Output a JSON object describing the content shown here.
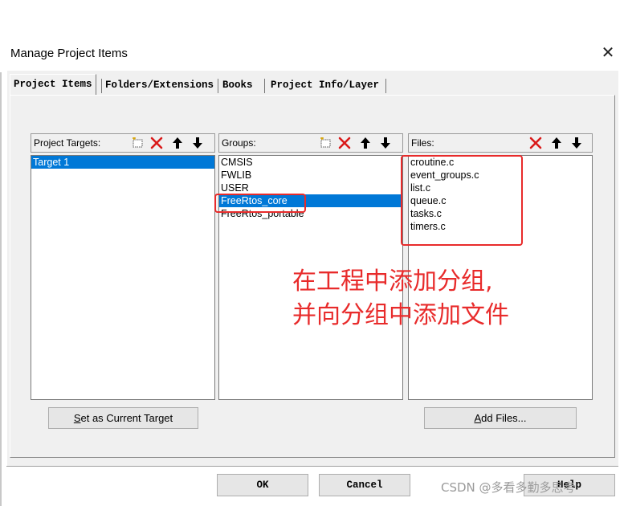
{
  "window": {
    "title": "Manage Project Items",
    "close_glyph": "✕"
  },
  "tabs": [
    {
      "label": "Project Items"
    },
    {
      "label": "Folders/Extensions"
    },
    {
      "label": "Books"
    },
    {
      "label": "Project Info/Layer"
    }
  ],
  "targets": {
    "header": "Project Targets:",
    "items": [
      "Target 1"
    ],
    "selected_index": 0,
    "set_button": "Set as Current Target",
    "set_button_mnemonic": "S"
  },
  "groups": {
    "header": "Groups:",
    "items": [
      "CMSIS",
      "FWLIB",
      "USER",
      "FreeRtos_core",
      "FreeRtos_portable"
    ],
    "selected_index": 3
  },
  "files": {
    "header": "Files:",
    "items": [
      "croutine.c",
      "event_groups.c",
      "list.c",
      "queue.c",
      "tasks.c",
      "timers.c"
    ],
    "add_button": "Add Files...",
    "add_button_mnemonic": "A"
  },
  "toolbar_icons": {
    "new": "new-item-icon",
    "delete": "delete-x-icon",
    "up": "move-up-arrow-icon",
    "down": "move-down-arrow-icon"
  },
  "footer": {
    "ok": "OK",
    "cancel": "Cancel",
    "help": "Help"
  },
  "annotation": {
    "line1": "在工程中添加分组,",
    "line2": "并向分组中添加文件",
    "color": "#e82b2b"
  },
  "watermark": "CSDN @多看多勤多思考",
  "colors": {
    "selection": "#0078d7",
    "dialog_bg": "#f0f0f0",
    "highlight_box": "#e82b2b"
  }
}
